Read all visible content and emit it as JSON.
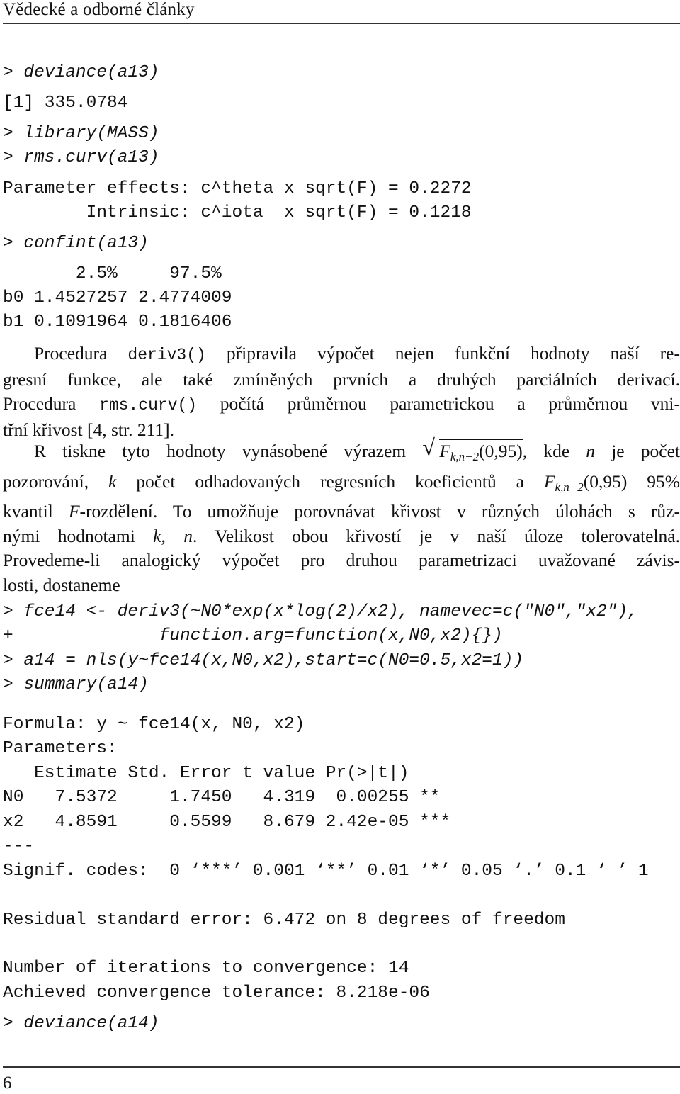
{
  "header": {
    "title": "Vědecké a odborné články"
  },
  "code_block_1": [
    {
      "type": "input",
      "text": "> deviance(a13)"
    },
    {
      "type": "output",
      "text": "[1] 335.0784"
    },
    {
      "type": "input",
      "text": "> library(MASS)"
    },
    {
      "type": "input",
      "text": "> rms.curv(a13)"
    },
    {
      "type": "output",
      "text": "Parameter effects: c^theta x sqrt(F) = 0.2272"
    },
    {
      "type": "output",
      "text": "        Intrinsic: c^iota  x sqrt(F) = 0.1218"
    },
    {
      "type": "input",
      "text": "> confint(a13)"
    },
    {
      "type": "output",
      "text": "       2.5%     97.5%"
    },
    {
      "type": "output",
      "text": "b0 1.4527257 2.4774009"
    },
    {
      "type": "output",
      "text": "b1 0.1091964 0.1816406"
    }
  ],
  "confint_table": {
    "columns": [
      "",
      "2.5%",
      "97.5%"
    ],
    "rows": [
      {
        "param": "b0",
        "lower": "1.4527257",
        "upper": "2.4774009"
      },
      {
        "param": "b1",
        "lower": "0.1091964",
        "upper": "0.1816406"
      }
    ]
  },
  "paragraph_1": {
    "lines": [
      {
        "pre": "Procedura ",
        "code": "deriv3()",
        "post": " připravila výpočet nejen funkční hodnoty naší re-"
      },
      {
        "text": "gresní funkce, ale také zmíněných prvních a druhých parciálních derivací."
      },
      {
        "pre": "Procedura ",
        "code": "rms.curv()",
        "post": " počítá průměrnou parametrickou a průměrnou vni-"
      },
      {
        "text": "třní křivost [4, str. 211]."
      }
    ]
  },
  "paragraph_2": {
    "line1_pre": "R tiskne tyto hodnoty vynásobené výrazem ",
    "sqrt_F": "F",
    "sqrt_sub": "k,n−2",
    "sqrt_arg": "(0,95)",
    "line1_post_a": ", kde ",
    "line1_n": "n",
    "line1_post_b": " je počet",
    "line2_pre": "pozorování, ",
    "line2_k": "k",
    "line2_mid": " počet odhadovaných regresních koeficientů a ",
    "line2_F": "F",
    "line2_sub": "k,n−2",
    "line2_post": "(0,95) 95%",
    "line3_pre": "kvantil ",
    "line3_F": "F",
    "line3_post": "-rozdělení. To umožňuje porovnávat křivost v různých úlohách s růz-",
    "line4_pre": "nými hodnotami ",
    "line4_k": "k",
    "line4_sep": ", ",
    "line4_n": "n",
    "line4_post": ". Velikost obou křivostí je v naší úloze tolerovatelná.",
    "line5": "Provedeme-li analogický výpočet pro druhou parametrizaci uvažované závis-",
    "line6": "losti, dostaneme"
  },
  "code_block_2": [
    {
      "type": "input",
      "text": "> fce14 <- deriv3(~N0*exp(x*log(2)/x2), namevec=c(\"N0\",\"x2\"),"
    },
    {
      "type": "input",
      "text": "+              function.arg=function(x,N0,x2){})"
    },
    {
      "type": "input",
      "text": "> a14 = nls(y~fce14(x,N0,x2),start=c(N0=0.5,x2=1))"
    },
    {
      "type": "input",
      "text": "> summary(a14)"
    }
  ],
  "summary_output": [
    {
      "type": "output",
      "text": "Formula: y ~ fce14(x, N0, x2)"
    },
    {
      "type": "output",
      "text": "Parameters:"
    },
    {
      "type": "output",
      "text": "   Estimate Std. Error t value Pr(>|t|)"
    },
    {
      "type": "output",
      "text": "N0   7.5372     1.7450   4.319  0.00255 **"
    },
    {
      "type": "output",
      "text": "x2   4.8591     0.5599   8.679 2.42e-05 ***"
    },
    {
      "type": "output",
      "text": "---"
    },
    {
      "type": "output",
      "text": "Signif. codes:  0 ‘***’ 0.001 ‘**’ 0.01 ‘*’ 0.05 ‘.’ 0.1 ‘ ’ 1"
    },
    {
      "type": "output",
      "text": "Residual standard error: 6.472 on 8 degrees of freedom"
    },
    {
      "type": "output",
      "text": "Number of iterations to convergence: 14"
    },
    {
      "type": "output",
      "text": "Achieved convergence tolerance: 8.218e-06"
    },
    {
      "type": "input",
      "text": "> deviance(a14)"
    }
  ],
  "parameters_table": {
    "columns": [
      "",
      "Estimate",
      "Std. Error",
      "t value",
      "Pr(>|t|)",
      ""
    ],
    "rows": [
      {
        "param": "N0",
        "estimate": "7.5372",
        "std_error": "1.7450",
        "t_value": "4.319",
        "p_value": "0.00255",
        "signif": "**"
      },
      {
        "param": "x2",
        "estimate": "4.8591",
        "std_error": "0.5599",
        "t_value": "8.679",
        "p_value": "2.42e-05",
        "signif": "***"
      }
    ]
  },
  "footer": {
    "page_number": "6"
  }
}
